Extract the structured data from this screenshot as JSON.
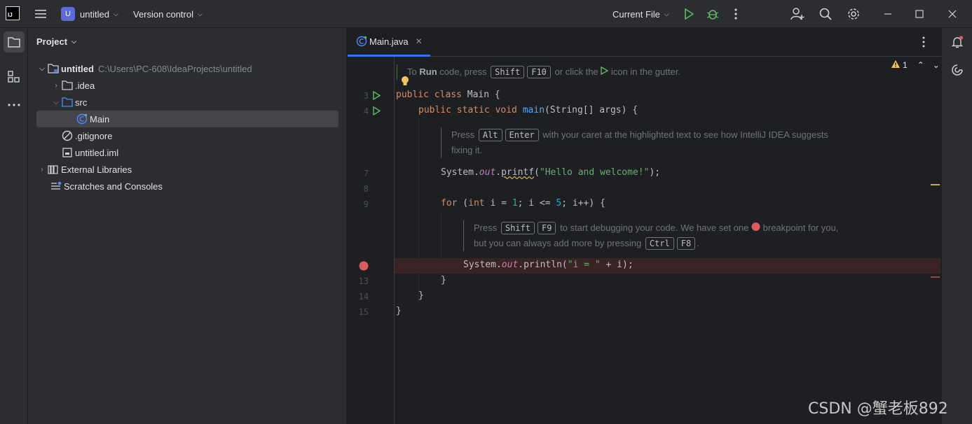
{
  "titlebar": {
    "logo_text": "IJ",
    "project_badge": "U",
    "project_name": "untitled",
    "vcs_label": "Version control",
    "run_config": "Current File"
  },
  "icons": [
    "menu-icon",
    "run-icon",
    "debug-icon",
    "more-icon",
    "add-user-icon",
    "search-icon",
    "settings-icon",
    "minimize-icon",
    "maximize-icon",
    "close-icon"
  ],
  "project_panel": {
    "title": "Project",
    "tree": [
      {
        "label": "untitled",
        "path": "C:\\Users\\PC-608\\IdeaProjects\\untitled"
      },
      {
        "label": ".idea"
      },
      {
        "label": "src"
      },
      {
        "label": "Main"
      },
      {
        "label": ".gitignore"
      },
      {
        "label": "untitled.iml"
      },
      {
        "label": "External Libraries"
      },
      {
        "label": "Scratches and Consoles"
      }
    ]
  },
  "editor": {
    "tab_label": "Main.java",
    "warning_count": "1",
    "line_numbers": [
      "3",
      "4",
      "7",
      "8",
      "9",
      "13",
      "14",
      "15"
    ],
    "hint1": {
      "pre": "To",
      "run": "Run",
      "mid": "code, press",
      "k1": "Shift",
      "k2": "F10",
      "post": "or click the",
      "post2": "icon in the gutter."
    },
    "hint2": {
      "pre": "Press",
      "k1": "Alt",
      "k2": "Enter",
      "post": "with your caret at the highlighted text to see how IntelliJ IDEA suggests",
      "line2": "fixing it."
    },
    "hint3": {
      "pre": "Press",
      "k1": "Shift",
      "k2": "F9",
      "post": "to start debugging your code. We have set one",
      "post2": "breakpoint for you,",
      "line2": "but you can always add more by pressing",
      "k3": "Ctrl",
      "k4": "F8",
      "end": "."
    },
    "code": {
      "l3_kw": "public class",
      "l3_rest": " Main {",
      "l4_kw": "public static void",
      "l4_fn": "main",
      "l4_rest": "(String[] args) {",
      "l7_a": "System.",
      "l7_out": "out",
      "l7_b": ".",
      "l7_fn": "printf",
      "l7_c": "(",
      "l7_str": "\"Hello and welcome!\"",
      "l7_d": ");",
      "l9_kw": "for",
      "l9_a": " (",
      "l9_int": "int",
      "l9_b": " i = ",
      "l9_n1": "1",
      "l9_c": "; i <= ",
      "l9_n2": "5",
      "l9_d": "; i++) {",
      "l12_a": "System.",
      "l12_out": "out",
      "l12_b": ".println(",
      "l12_str": "\"i = \"",
      "l12_c": " + i);",
      "l13": "}",
      "l14": "}",
      "l15": "}"
    }
  },
  "watermark": "CSDN @蟹老板892",
  "colors": {
    "accent": "#3574f0",
    "breakpoint": "#db5c5c",
    "run_green": "#5fb865"
  }
}
